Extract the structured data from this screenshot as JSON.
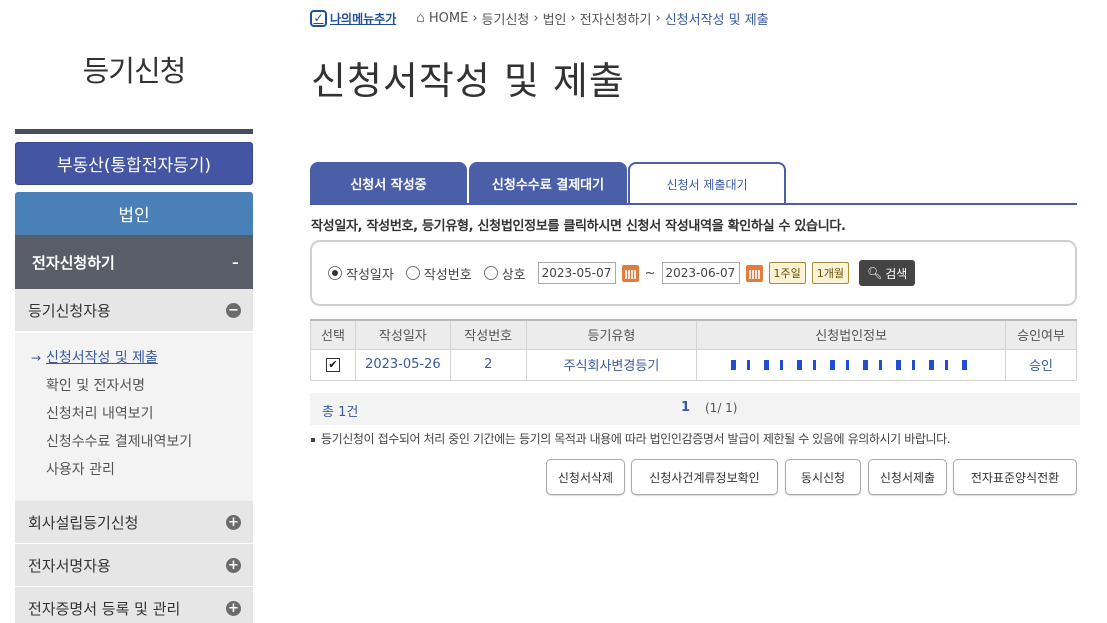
{
  "sidebar": {
    "title": "등기신청",
    "real_estate": "부동산(통합전자등기)",
    "corporation": "법인",
    "electronic_apply": "전자신청하기",
    "collapse_symbol": "-",
    "registration_use": "등기신청자용",
    "items": [
      {
        "label": "신청서작성 및 제출",
        "active": true
      },
      {
        "label": "확인 및 전자서명"
      },
      {
        "label": "신청처리 내역보기"
      },
      {
        "label": "신청수수료 결제내역보기"
      },
      {
        "label": "사용자 관리"
      }
    ],
    "categories": [
      "회사설립등기신청",
      "전자서명자용",
      "전자증명서 등록 및 관리"
    ]
  },
  "header": {
    "my_menu": "나의메뉴추가",
    "breadcrumb": [
      "HOME",
      "등기신청",
      "법인",
      "전자신청하기",
      "신청서작성 및 제출"
    ],
    "page_title": "신청서작성 및 제출"
  },
  "tabs": [
    {
      "label": "신청서 작성중",
      "active": false
    },
    {
      "label": "신청수수료 결제대기",
      "active": false
    },
    {
      "label": "신청서 제출대기",
      "active": true
    }
  ],
  "notice": "작성일자, 작성번호, 등기유형, 신청법인정보를 클릭하시면 신청서 작성내역을 확인하실 수 있습니다.",
  "search": {
    "options": [
      {
        "label": "작성일자",
        "selected": true
      },
      {
        "label": "작성번호",
        "selected": false
      },
      {
        "label": "상호",
        "selected": false
      }
    ],
    "date_from": "2023-05-07",
    "date_to": "2023-06-07",
    "tilde": "~",
    "week_btn": "1주일",
    "month_btn": "1개월",
    "search_btn": "검색"
  },
  "table": {
    "headers": [
      "선택",
      "작성일자",
      "작성번호",
      "등기유형",
      "신청법인정보",
      "승인여부"
    ],
    "rows": [
      {
        "checked": true,
        "check_mark": "✔",
        "date": "2023-05-26",
        "number": "2",
        "type": "주식회사변경등기",
        "approval": "승인"
      }
    ]
  },
  "pager": {
    "total": "총 1건",
    "current": "1",
    "of": "(1/ 1)"
  },
  "note": "등기신청이 접수되어 처리 중인 기간에는 등기의 목적과 내용에 따라 법인인감증명서 발급이 제한될 수 있음에 유의하시기 바랍니다.",
  "actions": [
    "신청서삭제",
    "신청사건계류정보확인",
    "동시신청",
    "신청서제출",
    "전자표준양식전환"
  ],
  "colors": {
    "primary": "#4a5fa8",
    "link": "#3a5aa0",
    "corp": "#4a80b8",
    "dark": "#595d68"
  }
}
